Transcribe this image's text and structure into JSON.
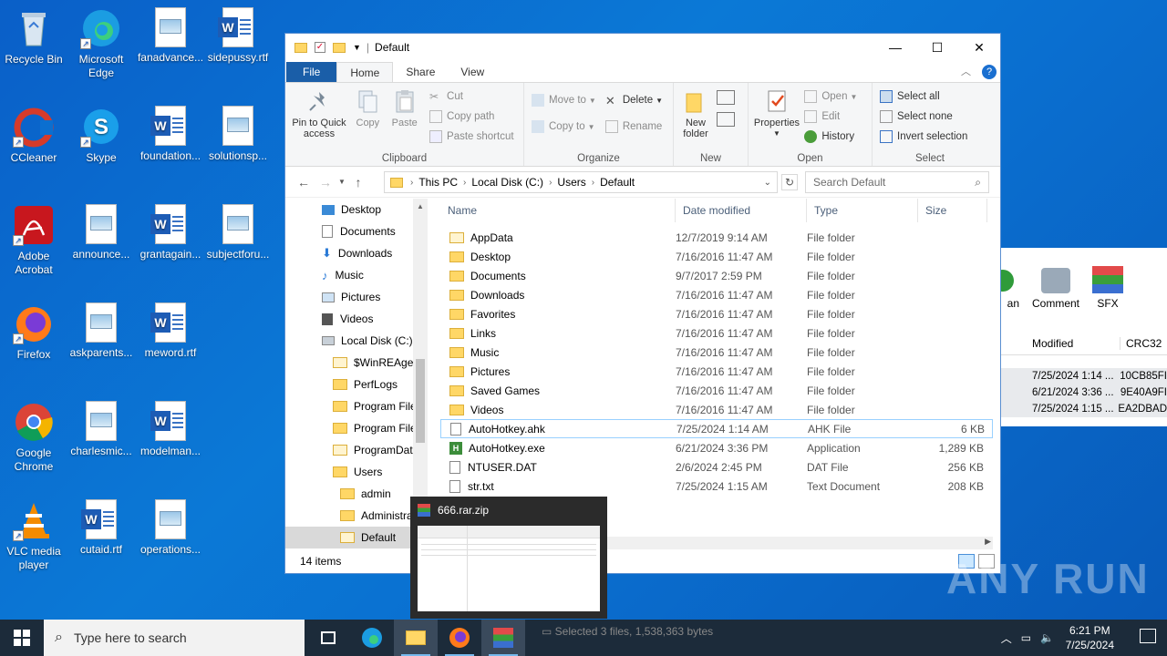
{
  "desktop": {
    "icons": [
      {
        "label": "Recycle Bin"
      },
      {
        "label": "Microsoft Edge"
      },
      {
        "label": "fanadvance..."
      },
      {
        "label": "sidepussy.rtf"
      },
      {
        "label": "CCleaner"
      },
      {
        "label": "Skype"
      },
      {
        "label": "foundation..."
      },
      {
        "label": "solutionsp..."
      },
      {
        "label": "Adobe Acrobat"
      },
      {
        "label": "announce..."
      },
      {
        "label": "grantagain..."
      },
      {
        "label": "subjectforu..."
      },
      {
        "label": "Firefox"
      },
      {
        "label": "askparents..."
      },
      {
        "label": "meword.rtf"
      },
      {
        "label": "Google Chrome"
      },
      {
        "label": "charlesmic..."
      },
      {
        "label": "modelman..."
      },
      {
        "label": "VLC media player"
      },
      {
        "label": "cutaid.rtf"
      },
      {
        "label": "operations..."
      }
    ]
  },
  "explorer": {
    "title": "Default",
    "tabs": {
      "file": "File",
      "home": "Home",
      "share": "Share",
      "view": "View"
    },
    "ribbon": {
      "clipboard": {
        "label": "Clipboard",
        "pin": "Pin to Quick access",
        "copy": "Copy",
        "paste": "Paste",
        "cut": "Cut",
        "copy_path": "Copy path",
        "paste_shortcut": "Paste shortcut"
      },
      "organize": {
        "label": "Organize",
        "move_to": "Move to",
        "copy_to": "Copy to",
        "delete": "Delete",
        "rename": "Rename"
      },
      "new": {
        "label": "New",
        "new_folder": "New folder"
      },
      "open": {
        "label": "Open",
        "properties": "Properties",
        "open": "Open",
        "edit": "Edit",
        "history": "History"
      },
      "select": {
        "label": "Select",
        "select_all": "Select all",
        "select_none": "Select none",
        "invert": "Invert selection"
      }
    },
    "address": {
      "crumbs": [
        "This PC",
        "Local Disk (C:)",
        "Users",
        "Default"
      ]
    },
    "search": {
      "placeholder": "Search Default"
    },
    "nav": [
      {
        "label": "Desktop"
      },
      {
        "label": "Documents"
      },
      {
        "label": "Downloads"
      },
      {
        "label": "Music"
      },
      {
        "label": "Pictures"
      },
      {
        "label": "Videos"
      },
      {
        "label": "Local Disk (C:)"
      },
      {
        "label": "$WinREAgent"
      },
      {
        "label": "PerfLogs"
      },
      {
        "label": "Program Files"
      },
      {
        "label": "Program Files"
      },
      {
        "label": "ProgramData"
      },
      {
        "label": "Users"
      },
      {
        "label": "admin"
      },
      {
        "label": "Administrat"
      },
      {
        "label": "Default"
      }
    ],
    "columns": {
      "name": "Name",
      "date": "Date modified",
      "type": "Type",
      "size": "Size"
    },
    "files": [
      {
        "name": "AppData",
        "date": "12/7/2019 9:14 AM",
        "type": "File folder",
        "size": ""
      },
      {
        "name": "Desktop",
        "date": "7/16/2016 11:47 AM",
        "type": "File folder",
        "size": ""
      },
      {
        "name": "Documents",
        "date": "9/7/2017 2:59 PM",
        "type": "File folder",
        "size": ""
      },
      {
        "name": "Downloads",
        "date": "7/16/2016 11:47 AM",
        "type": "File folder",
        "size": ""
      },
      {
        "name": "Favorites",
        "date": "7/16/2016 11:47 AM",
        "type": "File folder",
        "size": ""
      },
      {
        "name": "Links",
        "date": "7/16/2016 11:47 AM",
        "type": "File folder",
        "size": ""
      },
      {
        "name": "Music",
        "date": "7/16/2016 11:47 AM",
        "type": "File folder",
        "size": ""
      },
      {
        "name": "Pictures",
        "date": "7/16/2016 11:47 AM",
        "type": "File folder",
        "size": ""
      },
      {
        "name": "Saved Games",
        "date": "7/16/2016 11:47 AM",
        "type": "File folder",
        "size": ""
      },
      {
        "name": "Videos",
        "date": "7/16/2016 11:47 AM",
        "type": "File folder",
        "size": ""
      },
      {
        "name": "AutoHotkey.ahk",
        "date": "7/25/2024 1:14 AM",
        "type": "AHK File",
        "size": "6 KB"
      },
      {
        "name": "AutoHotkey.exe",
        "date": "6/21/2024 3:36 PM",
        "type": "Application",
        "size": "1,289 KB"
      },
      {
        "name": "NTUSER.DAT",
        "date": "2/6/2024 2:45 PM",
        "type": "DAT File",
        "size": "256 KB"
      },
      {
        "name": "str.txt",
        "date": "7/25/2024 1:15 AM",
        "type": "Text Document",
        "size": "208 KB"
      }
    ],
    "status": "14 items"
  },
  "winrar": {
    "tools": [
      "an",
      "Comment",
      "SFX"
    ],
    "columns": [
      "Modified",
      "CRC32"
    ],
    "rows": [
      {
        "modified": "7/25/2024 1:14 ...",
        "crc": "10CB85FI"
      },
      {
        "modified": "6/21/2024 3:36 ...",
        "crc": "9E40A9FI"
      },
      {
        "modified": "7/25/2024 1:15 ...",
        "crc": "EA2DBAD"
      }
    ],
    "status": "Selected 3 files, 1,538,363 bytes"
  },
  "thumbnail": {
    "title": "666.rar.zip"
  },
  "taskbar": {
    "search_placeholder": "Type here to search",
    "time": "6:21 PM",
    "date": "7/25/2024"
  },
  "watermark": "ANY RUN"
}
